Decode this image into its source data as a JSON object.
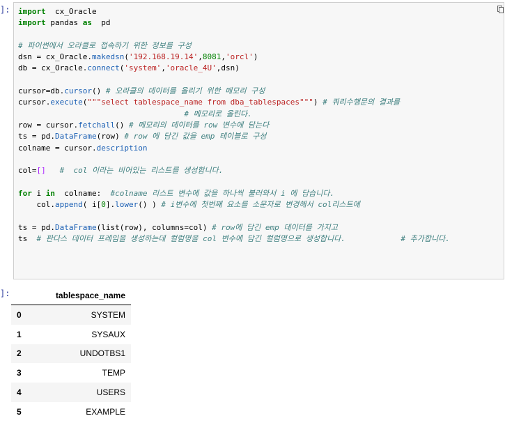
{
  "input_prompt": "]:",
  "output_prompt": "]:",
  "code": {
    "line1_kw": "import",
    "line1_rest": "  cx_Oracle",
    "line2_kw": "import",
    "line2_mid": " pandas ",
    "line2_kw2": "as",
    "line2_rest": "  pd",
    "line4_comment": "# 파이썬에서 오라클로 접속하기 위한 정보를 구성",
    "line5_a": "dsn = cx_Oracle.",
    "line5_fn": "makedsn",
    "line5_b": "(",
    "line5_s1": "'192.168.19.14'",
    "line5_c": ",",
    "line5_n": "8081",
    "line5_d": ",",
    "line5_s2": "'orcl'",
    "line5_e": ")",
    "line6_a": "db = cx_Oracle.",
    "line6_fn": "connect",
    "line6_b": "(",
    "line6_s1": "'system'",
    "line6_c": ",",
    "line6_s2": "'oracle_4U'",
    "line6_d": ",dsn)",
    "line8_a": "cursor=db.",
    "line8_fn": "cursor",
    "line8_b": "() ",
    "line8_comment": "# 오라클의 데이터를 올리기 위한 메모리 구성",
    "line9_a": "cursor.",
    "line9_fn": "execute",
    "line9_b": "(",
    "line9_s": "\"\"\"select tablespace_name from dba_tablespaces\"\"\"",
    "line9_c": ") ",
    "line9_comment": "# 쿼리수행문의 결과를",
    "line10_comment": "                                    # 메모리로 올린다.",
    "line11_a": "row = cursor.",
    "line11_fn": "fetchall",
    "line11_b": "() ",
    "line11_comment": "# 메모리의 데이터를 row 변수에 담는다",
    "line12_a": "ts = pd.",
    "line12_fn": "DataFrame",
    "line12_b": "(row) ",
    "line12_comment": "# row 에 담긴 값을 emp 테이블로 구성",
    "line13_a": "colname = cursor.",
    "line13_attr": "description",
    "line15_a": "col=",
    "line15_b": "[]",
    "line15_c": "   ",
    "line15_comment": "#  col 이라는 비어있는 리스트를 생성합니다.",
    "line17_kw1": "for",
    "line17_a": " i ",
    "line17_kw2": "in",
    "line17_b": "  colname:  ",
    "line17_comment": "#colname 리스트 변수에 값을 하나씩 불러와서 i 에 담습니다.",
    "line18_a": "    col.",
    "line18_fn": "append",
    "line18_b": "( i[",
    "line18_n": "0",
    "line18_c": "].",
    "line18_fn2": "lower",
    "line18_d": "() ) ",
    "line18_comment": "# i변수에 첫번째 요소를 소문자로 변경해서 col리스트에",
    "line20_a": "ts = pd.",
    "line20_fn": "DataFrame",
    "line20_b": "(list(row), columns=col) ",
    "line20_comment": "# row에 담긴 emp 데이터를 가지고",
    "line21_a": "ts  ",
    "line21_comment": "# 판다스 데이터 프레임을 생성하는데 컬럼명을 col 변수에 담긴 컬럼명으로 생성합니다.            # 추가합니다."
  },
  "table": {
    "header": "tablespace_name",
    "rows": [
      {
        "index": "0",
        "value": "SYSTEM"
      },
      {
        "index": "1",
        "value": "SYSAUX"
      },
      {
        "index": "2",
        "value": "UNDOTBS1"
      },
      {
        "index": "3",
        "value": "TEMP"
      },
      {
        "index": "4",
        "value": "USERS"
      },
      {
        "index": "5",
        "value": "EXAMPLE"
      }
    ]
  }
}
